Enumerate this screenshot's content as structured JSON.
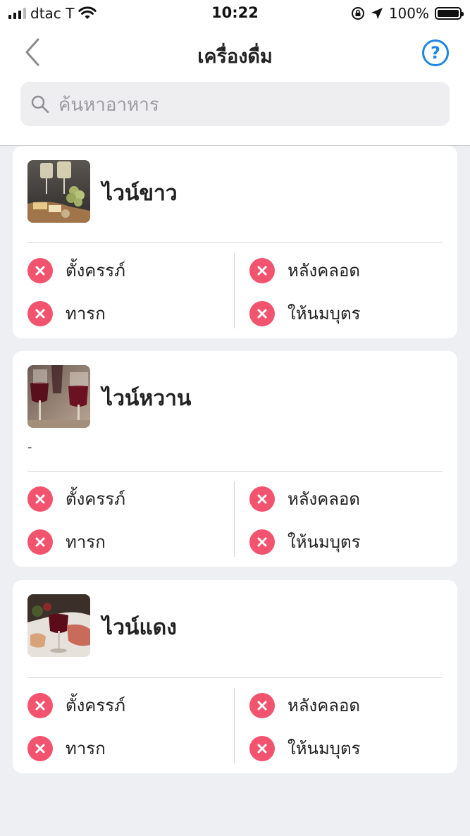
{
  "status_bar": {
    "carrier": "dtac T",
    "time": "10:22",
    "battery": "100%",
    "battery_level": 1.0
  },
  "nav": {
    "title": "เครื่องดื่ม",
    "help": "?"
  },
  "search": {
    "placeholder": "ค้นหาอาหาร",
    "value": ""
  },
  "colors": {
    "accent": "#1f86e6",
    "not_allowed": "#f2546f",
    "background": "#eeeff3"
  },
  "items": [
    {
      "name": "ไวน์ขาว",
      "description": "",
      "image": "white-wine-photo",
      "statuses": {
        "pregnant": "ตั้งครรภ์",
        "postpartum": "หลังคลอด",
        "baby": "ทารก",
        "breastfeeding": "ให้นมบุตร"
      },
      "status_icon": "x-circle-icon"
    },
    {
      "name": "ไวน์หวาน",
      "description": "-",
      "image": "sweet-wine-photo",
      "statuses": {
        "pregnant": "ตั้งครรภ์",
        "postpartum": "หลังคลอด",
        "baby": "ทารก",
        "breastfeeding": "ให้นมบุตร"
      },
      "status_icon": "x-circle-icon"
    },
    {
      "name": "ไวน์แดง",
      "description": "",
      "image": "red-wine-photo",
      "statuses": {
        "pregnant": "ตั้งครรภ์",
        "postpartum": "หลังคลอด",
        "baby": "ทารก",
        "breastfeeding": "ให้นมบุตร"
      },
      "status_icon": "x-circle-icon"
    }
  ]
}
